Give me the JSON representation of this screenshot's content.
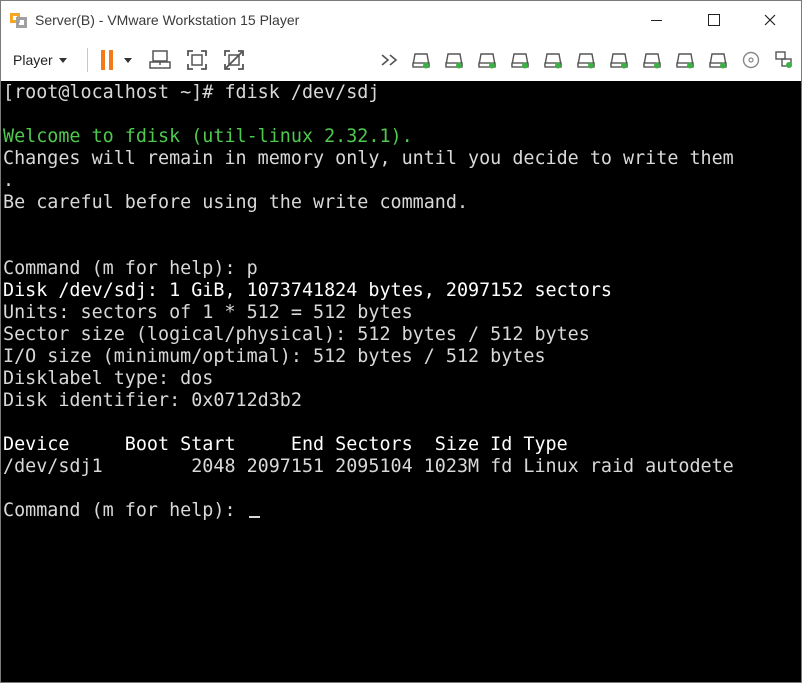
{
  "window": {
    "title": "Server(B) - VMware Workstation 15 Player"
  },
  "toolbar": {
    "player_label": "Player",
    "devices": [
      "hard-disk",
      "hard-disk",
      "hard-disk",
      "hard-disk",
      "hard-disk",
      "hard-disk",
      "hard-disk",
      "hard-disk",
      "hard-disk",
      "hard-disk",
      "cd-rom",
      "network"
    ]
  },
  "colors": {
    "pause_orange": "#f07a1c",
    "device_green": "#3cb043",
    "console_bg": "#000000",
    "console_fg": "#d8d8d8",
    "console_green": "#4ec94e"
  },
  "console": {
    "lines": [
      {
        "text": "[root@localhost ~]# fdisk /dev/sdj",
        "style": "normal"
      },
      {
        "text": "",
        "style": "normal"
      },
      {
        "text": "Welcome to fdisk (util-linux 2.32.1).",
        "style": "green"
      },
      {
        "text": "Changes will remain in memory only, until you decide to write them",
        "style": "normal"
      },
      {
        "text": ".",
        "style": "normal"
      },
      {
        "text": "Be careful before using the write command.",
        "style": "normal"
      },
      {
        "text": "",
        "style": "normal"
      },
      {
        "text": "",
        "style": "normal"
      },
      {
        "text": "Command (m for help): p",
        "style": "normal"
      },
      {
        "text": "Disk /dev/sdj: 1 GiB, 1073741824 bytes, 2097152 sectors",
        "style": "bright"
      },
      {
        "text": "Units: sectors of 1 * 512 = 512 bytes",
        "style": "normal"
      },
      {
        "text": "Sector size (logical/physical): 512 bytes / 512 bytes",
        "style": "normal"
      },
      {
        "text": "I/O size (minimum/optimal): 512 bytes / 512 bytes",
        "style": "normal"
      },
      {
        "text": "Disklabel type: dos",
        "style": "normal"
      },
      {
        "text": "Disk identifier: 0x0712d3b2",
        "style": "normal"
      },
      {
        "text": "",
        "style": "normal"
      },
      {
        "text": "Device     Boot Start     End Sectors  Size Id Type",
        "style": "bright"
      },
      {
        "text": "/dev/sdj1        2048 2097151 2095104 1023M fd Linux raid autodete",
        "style": "normal"
      },
      {
        "text": "",
        "style": "normal"
      },
      {
        "text": "Command (m for help): ",
        "style": "normal"
      }
    ]
  }
}
